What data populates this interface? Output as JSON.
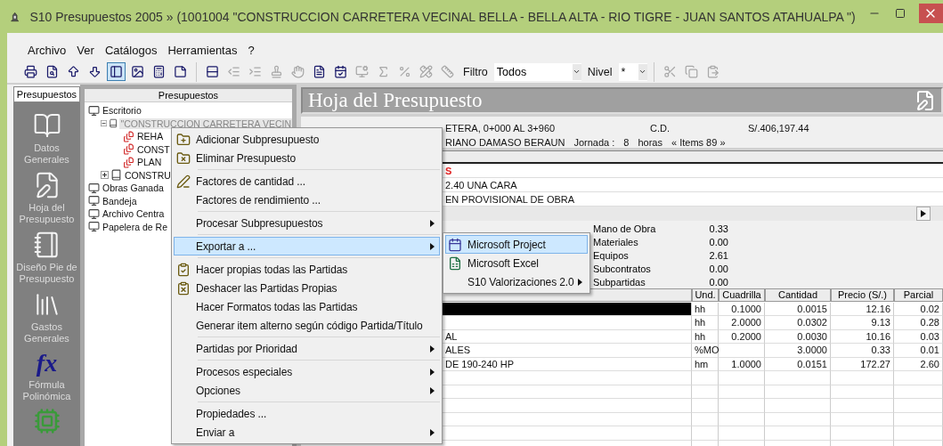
{
  "window": {
    "title": "S10 Presupuestos 2005 » (1001004 \"CONSTRUCCION CARRETERA VECINAL BELLA - BELLA ALTA - RIO TIGRE - JUAN SANTOS ATAHUALPA \")"
  },
  "menu_bar": [
    "Archivo",
    "Ver",
    "Catálogos",
    "Herramientas",
    "?"
  ],
  "toolbar": {
    "icons": [
      {
        "selected": false,
        "disabled": false
      },
      {
        "selected": false,
        "disabled": false
      },
      {
        "selected": false,
        "disabled": false
      },
      {
        "selected": false,
        "disabled": false
      },
      {
        "selected": true,
        "disabled": false
      },
      {
        "selected": false,
        "disabled": false
      },
      {
        "selected": false,
        "disabled": false
      },
      {
        "selected": false,
        "disabled": false
      }
    ],
    "tools": [
      {
        "disabled": false
      },
      {
        "disabled": true
      },
      {
        "disabled": true
      },
      {
        "disabled": true
      },
      {
        "disabled": true
      },
      {
        "disabled": false
      },
      {
        "disabled": false
      },
      {
        "disabled": true
      },
      {
        "disabled": true
      },
      {
        "disabled": true
      },
      {
        "disabled": true
      },
      {
        "disabled": true
      }
    ],
    "filter_label": "Filtro",
    "filter_value": "Todos",
    "level_label": "Nivel",
    "level_value": "*"
  },
  "sidebar": {
    "tab": "Presupuestos",
    "items": [
      {
        "label": "Datos Generales"
      },
      {
        "label": "Hoja del Presupuesto"
      },
      {
        "label": "Diseño Pie de Presupuesto"
      },
      {
        "label": "Gastos Generales"
      },
      {
        "label": "Fórmula Polinómica",
        "glyph": "fx"
      }
    ]
  },
  "tree": {
    "header": "Presupuestos",
    "items": [
      {
        "label": "Escritorio",
        "children": [
          {
            "label": "\"CONSTRUCCION CARRETERA VECIN",
            "expanded": true,
            "selected": true,
            "children": [
              {
                "label": "REHA"
              },
              {
                "label": "CONST"
              },
              {
                "label": "PLAN"
              }
            ]
          },
          {
            "label": "CONSTRU",
            "expanded": false
          }
        ]
      },
      {
        "label": "Obras Ganada"
      },
      {
        "label": "Bandeja"
      },
      {
        "label": "Archivo Centra"
      },
      {
        "label": "Papelera de Re"
      }
    ]
  },
  "sheet": {
    "title": "Hoja del Presupuesto",
    "info": {
      "work": "ETERA, 0+000 AL 3+960",
      "cd_label": "C.D.",
      "cd_value": "S/.406,197.44",
      "client": "RIANO DAMASO BERAUN",
      "shift_label": "Jornada :",
      "shift_value": "8",
      "shift_unit": "horas",
      "items": "« Items 89 »"
    },
    "items_grid": [
      {
        "kind": "title",
        "text": "S"
      },
      {
        "kind": "item",
        "text": "2.40 UNA CARA"
      },
      {
        "kind": "item",
        "text": "EN PROVISIONAL DE OBRA"
      }
    ],
    "cost_summary": [
      {
        "label": "Mano de Obra",
        "value": "0.33"
      },
      {
        "label": "Materiales",
        "value": "0.00"
      },
      {
        "label": "Equipos",
        "value": "2.61"
      },
      {
        "label": "Subcontratos",
        "value": "0.00"
      },
      {
        "label": "Subpartidas",
        "value": "0.00"
      }
    ],
    "resources": {
      "columns": [
        "Und.",
        "Cuadrilla",
        "Cantidad",
        "Precio (S/.)",
        "Parcial"
      ],
      "rows": [
        {
          "selected": true,
          "cells": [
            "hh",
            "0.1000",
            "0.0015",
            "12.16",
            "0.02"
          ]
        },
        {
          "selected": false,
          "cells": [
            "hh",
            "2.0000",
            "0.0302",
            "9.13",
            "0.28"
          ]
        },
        {
          "selected": false,
          "description": "AL",
          "cells": [
            "hh",
            "0.2000",
            "0.0030",
            "10.16",
            "0.03"
          ]
        },
        {
          "selected": false,
          "description": "ALES",
          "cells": [
            "%MO",
            "",
            "3.0000",
            "0.33",
            "0.01"
          ]
        },
        {
          "selected": false,
          "description": "DE 190-240 HP",
          "cells": [
            "hm",
            "1.0000",
            "0.0151",
            "172.27",
            "2.60"
          ]
        }
      ]
    }
  },
  "context_menu": {
    "items": [
      {
        "kind": "item",
        "label": "Adicionar Subpresupuesto",
        "submenu": false,
        "selected": false
      },
      {
        "kind": "item",
        "label": "Eliminar Presupuesto",
        "submenu": false,
        "selected": false
      },
      {
        "kind": "separator"
      },
      {
        "kind": "item",
        "label": "Factores de cantidad ...",
        "submenu": false,
        "selected": false
      },
      {
        "kind": "item",
        "label": "Factores de rendimiento ...",
        "submenu": false,
        "selected": false
      },
      {
        "kind": "separator"
      },
      {
        "kind": "item",
        "label": "Procesar Subpresupuestos",
        "submenu": true,
        "selected": false
      },
      {
        "kind": "separator"
      },
      {
        "kind": "item",
        "label": "Exportar a ...",
        "submenu": true,
        "selected": true
      },
      {
        "kind": "separator"
      },
      {
        "kind": "item",
        "label": "Hacer propias todas las Partidas",
        "submenu": false,
        "selected": false
      },
      {
        "kind": "item",
        "label": "Deshacer las Partidas Propias",
        "submenu": false,
        "selected": false
      },
      {
        "kind": "item",
        "label": "Hacer Formatos todas las Partidas",
        "submenu": false,
        "selected": false
      },
      {
        "kind": "item",
        "label": "Generar item alterno según código Partida/Título",
        "submenu": false,
        "selected": false
      },
      {
        "kind": "separator"
      },
      {
        "kind": "item",
        "label": "Partidas por Prioridad",
        "submenu": true,
        "selected": false
      },
      {
        "kind": "separator"
      },
      {
        "kind": "item",
        "label": "Procesos especiales",
        "submenu": true,
        "selected": false
      },
      {
        "kind": "item",
        "label": "Opciones",
        "submenu": true,
        "selected": false
      },
      {
        "kind": "separator"
      },
      {
        "kind": "item",
        "label": "Propiedades ...",
        "submenu": false,
        "selected": false
      },
      {
        "kind": "item",
        "label": "Enviar a",
        "submenu": true,
        "selected": false
      }
    ]
  },
  "export_submenu": {
    "items": [
      {
        "label": "Microsoft Project",
        "submenu": false,
        "selected": true
      },
      {
        "label": "Microsoft Excel",
        "submenu": false,
        "selected": false
      },
      {
        "label": "S10 Valorizaciones 2.0",
        "submenu": true,
        "selected": false
      }
    ]
  }
}
